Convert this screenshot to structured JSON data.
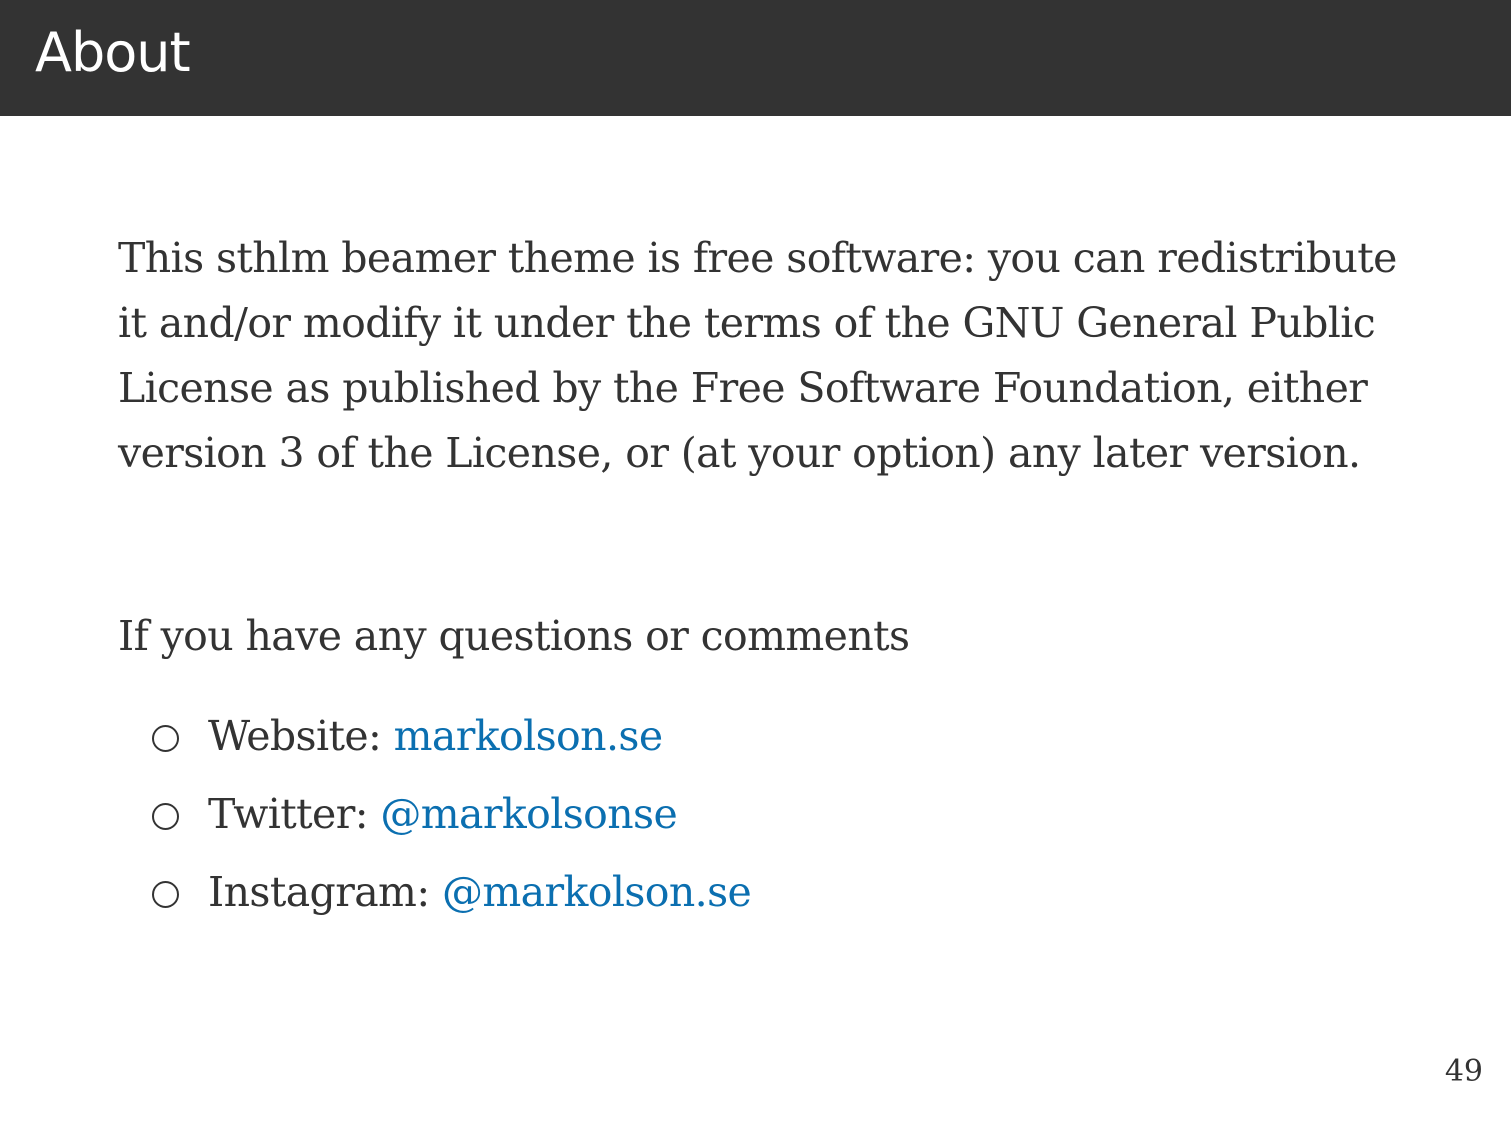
{
  "header": {
    "title": "About"
  },
  "license": {
    "lines": [
      "This sthlm beamer theme is free software:  you can redistribute",
      "it and/or modify it under the terms of the GNU General Public",
      "License as published by the Free Software Foundation, either",
      "version 3 of the License, or (at your option) any later version."
    ]
  },
  "contact": {
    "intro": "If you have any questions or comments",
    "items": [
      {
        "label": "Website: ",
        "value": "markolson.se",
        "icon": "circle-bullet-icon"
      },
      {
        "label": "Twitter: ",
        "value": "@markolsonse",
        "icon": "circle-bullet-icon"
      },
      {
        "label": "Instagram: ",
        "value": "@markolson.se",
        "icon": "circle-bullet-icon"
      }
    ]
  },
  "footer": {
    "page_number": "49"
  },
  "colors": {
    "title_bar": "#333333",
    "text": "#333333",
    "link": "#0b6fb0",
    "background": "#ffffff"
  }
}
